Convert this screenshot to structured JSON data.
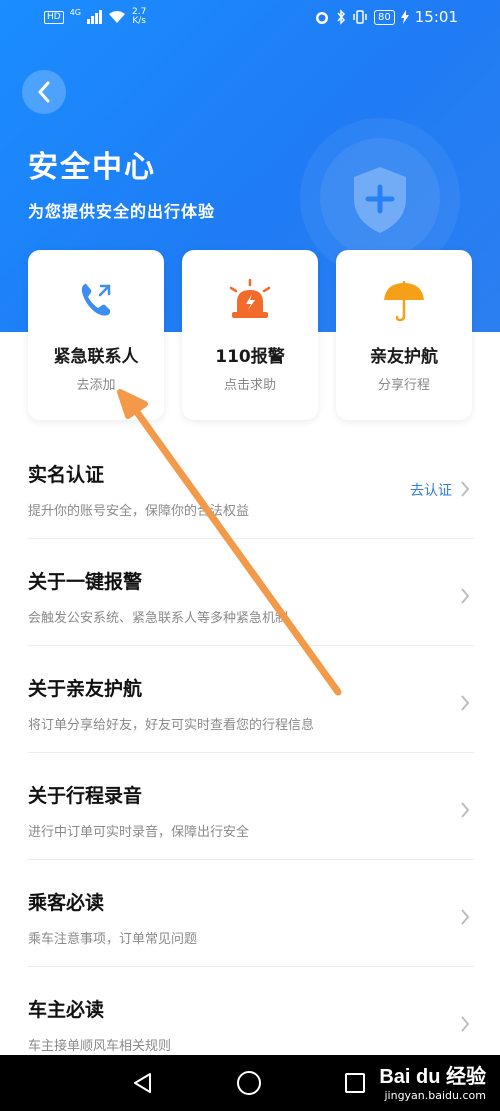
{
  "status_bar": {
    "hd": "HD",
    "net": "4G",
    "speed_value": "2.7",
    "speed_unit": "K/s",
    "battery": "80",
    "time": "15:01"
  },
  "header": {
    "title": "安全中心",
    "subtitle": "为您提供安全的出行体验"
  },
  "cards": [
    {
      "title": "紧急联系人",
      "sub": "去添加",
      "icon": "phone-icon"
    },
    {
      "title": "110报警",
      "sub": "点击求助",
      "icon": "alarm-light-icon"
    },
    {
      "title": "亲友护航",
      "sub": "分享行程",
      "icon": "umbrella-icon"
    }
  ],
  "list": [
    {
      "title": "实名认证",
      "sub": "提升你的账号安全，保障你的合法权益",
      "action": "去认证"
    },
    {
      "title": "关于一键报警",
      "sub": "会触发公安系统、紧急联系人等多种紧急机制"
    },
    {
      "title": "关于亲友护航",
      "sub": "将订单分享给好友，好友可实时查看您的行程信息"
    },
    {
      "title": "关于行程录音",
      "sub": "进行中订单可实时录音，保障出行安全"
    },
    {
      "title": "乘客必读",
      "sub": "乘车注意事项，订单常见问题"
    },
    {
      "title": "车主必读",
      "sub": "车主接单顺风车相关规则"
    }
  ],
  "watermark": {
    "brand": "Bai du 经验",
    "url": "jingyan.baidu.com"
  },
  "colors": {
    "hero_blue": "#1f7cf4",
    "accent_blue": "#2f7de1",
    "alarm_orange": "#f36b2b",
    "umbrella_orange": "#f6a01a",
    "arrow_orange": "#f39a4a"
  }
}
